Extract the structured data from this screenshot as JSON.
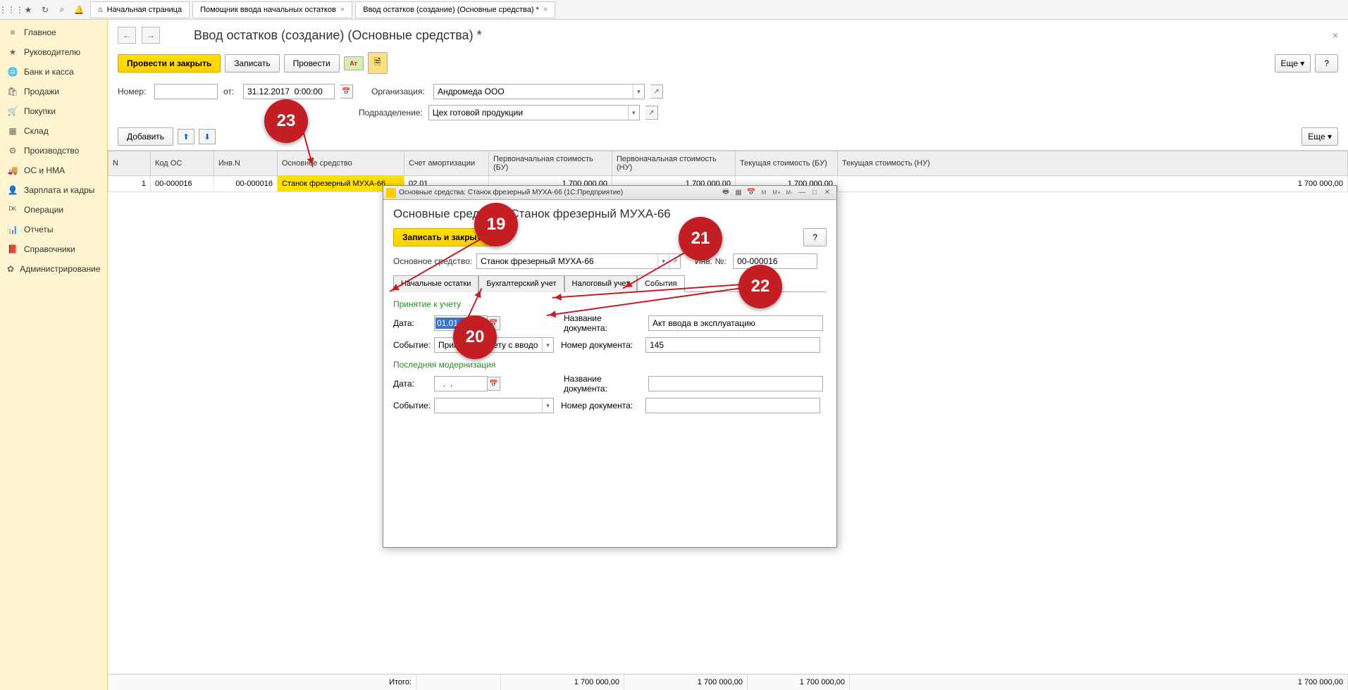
{
  "topbar": {
    "tabs": [
      {
        "icon": "home",
        "label": "Начальная страница"
      },
      {
        "icon": "",
        "label": "Помощник ввода начальных остатков",
        "closable": true
      },
      {
        "icon": "",
        "label": "Ввод остатков (создание) (Основные средства) *",
        "closable": true,
        "active": true
      }
    ]
  },
  "sidebar": {
    "items": [
      {
        "icon": "menu",
        "label": "Главное"
      },
      {
        "icon": "user",
        "label": "Руководителю"
      },
      {
        "icon": "globe",
        "label": "Банк и касса"
      },
      {
        "icon": "tag",
        "label": "Продажи"
      },
      {
        "icon": "cart",
        "label": "Покупки"
      },
      {
        "icon": "boxes",
        "label": "Склад"
      },
      {
        "icon": "gear",
        "label": "Производство"
      },
      {
        "icon": "truck",
        "label": "ОС и НМА"
      },
      {
        "icon": "person",
        "label": "Зарплата и кадры"
      },
      {
        "icon": "ops",
        "label": "Операции"
      },
      {
        "icon": "chart",
        "label": "Отчеты"
      },
      {
        "icon": "book",
        "label": "Справочники"
      },
      {
        "icon": "cog",
        "label": "Администрирование"
      }
    ]
  },
  "page": {
    "title": "Ввод остатков (создание) (Основные средства) *",
    "actions": {
      "post_close": "Провести и закрыть",
      "save": "Записать",
      "post": "Провести",
      "more": "Еще",
      "help": "?"
    },
    "form": {
      "number_label": "Номер:",
      "number_value": "",
      "date_label": "от:",
      "date_value": "31.12.2017  0:00:00",
      "org_label": "Организация:",
      "org_value": "Андромеда ООО",
      "dept_label": "Подразделение:",
      "dept_value": "Цех готовой продукции"
    },
    "table_toolbar": {
      "add": "Добавить",
      "more": "Еще"
    },
    "table": {
      "headers": [
        "N",
        "Код ОС",
        "Инв.N",
        "Основное средство",
        "Счет амортизации",
        "Первоначальная стоимость (БУ)",
        "Первоначальная стоимость (НУ)",
        "Текущая стоимость (БУ)",
        "Текущая стоимость (НУ)"
      ],
      "rows": [
        {
          "n": "1",
          "code": "00-000016",
          "inv": "00-000016",
          "name": "Станок фрезерный МУХА-66",
          "acct": "02.01",
          "cost_bu": "1 700 000,00",
          "cost_nu": "1 700 000,00",
          "cur_bu": "1 700 000,00",
          "cur_nu": "1 700 000,00"
        }
      ],
      "footer": {
        "label": "Итого:",
        "cost_bu": "1 700 000,00",
        "cost_nu": "1 700 000,00",
        "cur_bu": "1 700 000,00",
        "cur_nu": "1 700 000,00"
      }
    }
  },
  "modal": {
    "window_title": "Основные средства: Станок фрезерный МУХА-66  (1С:Предприятие)",
    "heading": "Основные средства: Станок фрезерный МУХА-66",
    "save_close": "Записать и закрыть",
    "help": "?",
    "asset_label": "Основное средство:",
    "asset_value": "Станок фрезерный МУХА-66",
    "inv_label": "Инв. №:",
    "inv_value": "00-000016",
    "tabs": [
      "Начальные остатки",
      "Бухгалтерский учет",
      "Налоговый учет",
      "События"
    ],
    "active_tab": 3,
    "sections": {
      "accept": {
        "title": "Принятие к учету",
        "date_label": "Дата:",
        "date_value": "01.01.2013",
        "event_label": "Событие:",
        "event_value": "Принятие к учету с вводом в эк",
        "docname_label": "Название документа:",
        "docname_value": "Акт ввода в эксплуатацию",
        "docnum_label": "Номер документа:",
        "docnum_value": "145"
      },
      "modern": {
        "title": "Последняя модернизация",
        "date_label": "Дата:",
        "date_value": "  .  .    ",
        "event_label": "Событие:",
        "event_value": "",
        "docname_label": "Название документа:",
        "docname_value": "",
        "docnum_label": "Номер документа:",
        "docnum_value": ""
      }
    }
  },
  "annotations": {
    "a19": "19",
    "a20": "20",
    "a21": "21",
    "a22": "22",
    "a23": "23"
  }
}
